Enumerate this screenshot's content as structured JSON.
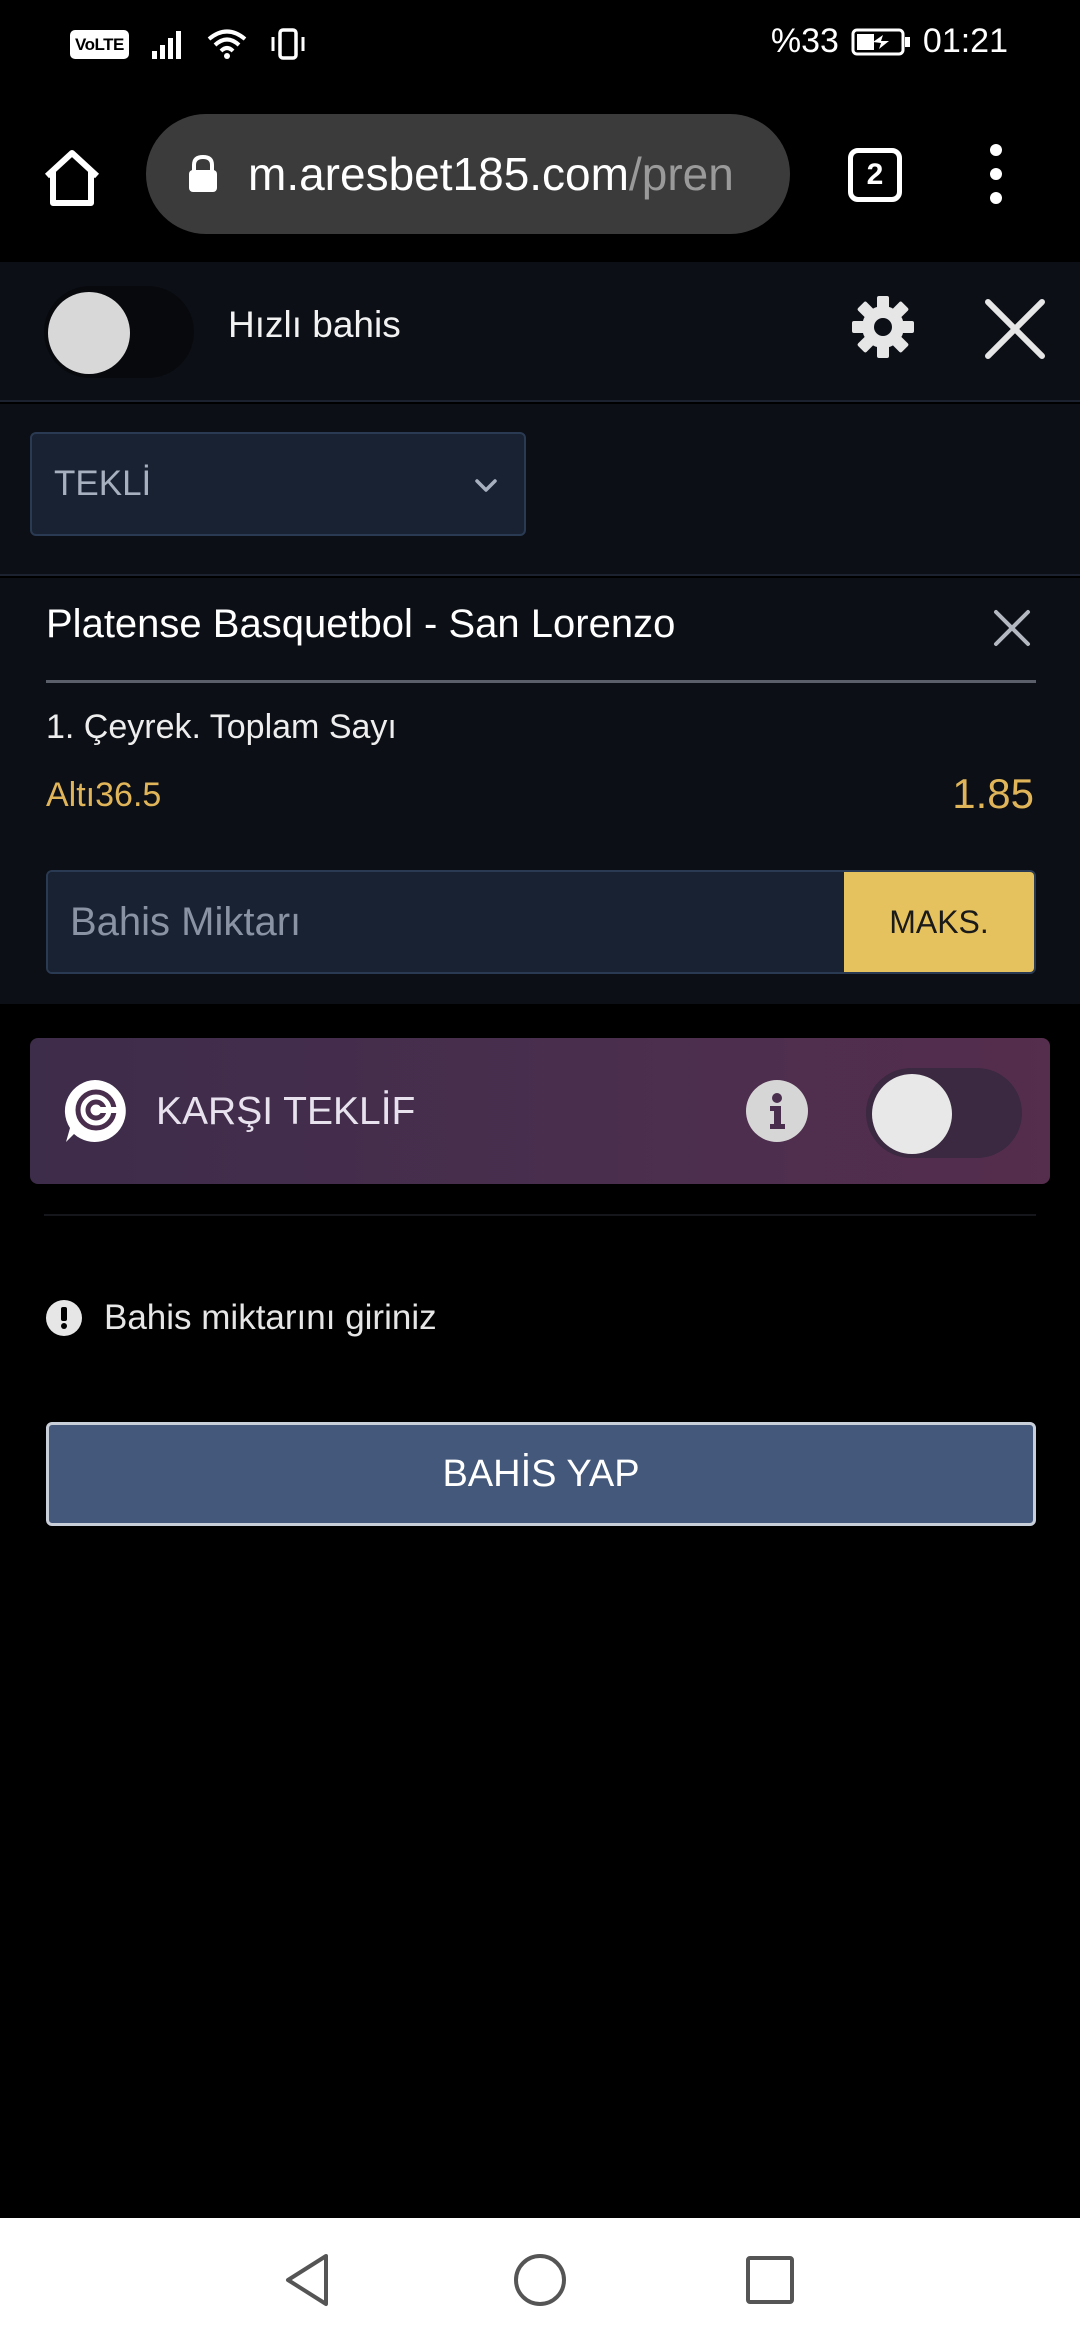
{
  "status_bar": {
    "volte": "VoLTE",
    "battery": "%33",
    "time": "01:21",
    "icons": [
      "signal-icon",
      "wifi-icon",
      "vibrate-icon",
      "battery-charging-icon"
    ]
  },
  "browser": {
    "url_host": "m.aresbet185.com",
    "url_path": "/pren",
    "tab_count": "2",
    "icons": [
      "home-icon",
      "lock-icon",
      "more-vert-icon"
    ]
  },
  "slip": {
    "quick_bet_label": "Hızlı bahis",
    "quick_bet_enabled": false,
    "icons": [
      "gear-icon",
      "close-icon"
    ],
    "bet_type": "TEKLİ"
  },
  "selection": {
    "match": "Platense Basquetbol - San Lorenzo",
    "market": "1. Çeyrek. Toplam Sayı",
    "outcome": "Altı36.5",
    "odds": "1.85",
    "stake_placeholder": "Bahis Miktarı",
    "max_label": "MAKS."
  },
  "counter_offer": {
    "label": "KARŞI TEKLİF",
    "enabled": false,
    "icons": [
      "counter-offer-icon",
      "info-icon"
    ]
  },
  "warning": {
    "text": "Bahis miktarını giriniz"
  },
  "place_bet_label": "BAHİS YAP",
  "colors": {
    "accent_gold": "#e6c25e",
    "odds_gold": "#e0b55a",
    "panel_bg": "#0c0f16",
    "button_blue": "#43587b",
    "counter_purple": "#4a2e4e"
  }
}
